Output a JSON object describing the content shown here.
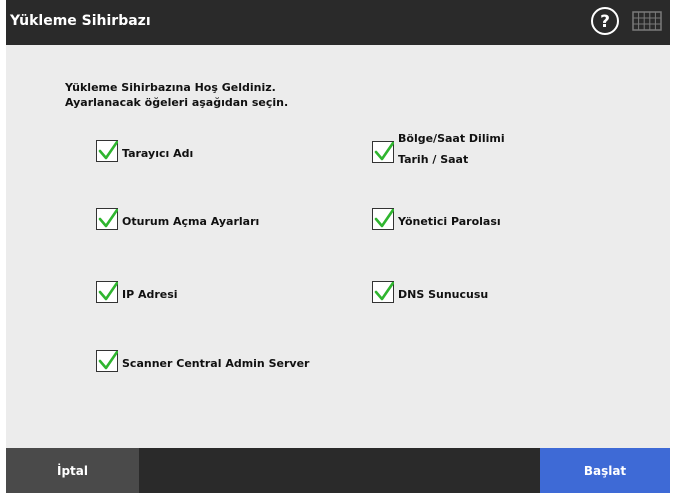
{
  "window": {
    "title": "Yükleme Sihirbazı"
  },
  "header": {
    "help_icon": "question-circle-icon",
    "keyboard_icon": "keyboard-icon"
  },
  "intro": {
    "line1": "Yükleme Sihirbazına Hoş Geldiniz.",
    "line2": "Ayarlanacak öğeleri aşağıdan seçin."
  },
  "options": {
    "scanner_name": {
      "label": "Tarayıcı Adı",
      "checked": true
    },
    "region_time": {
      "label_line1": "Bölge/Saat Dilimi",
      "label_line2": "Tarih / Saat",
      "checked": true
    },
    "logon_settings": {
      "label": "Oturum Açma Ayarları",
      "checked": true
    },
    "admin_password": {
      "label": "Yönetici Parolası",
      "checked": true
    },
    "ip_address": {
      "label": "IP Adresi",
      "checked": true
    },
    "dns_server": {
      "label": "DNS Sunucusu",
      "checked": true
    },
    "scanner_central": {
      "label": "Scanner Central Admin Server",
      "checked": true
    }
  },
  "footer": {
    "cancel_label": "İptal",
    "start_label": "Başlat"
  },
  "colors": {
    "titlebar": "#2a2a2a",
    "background": "#ececec",
    "checkmark": "#2fb52f",
    "start_button": "#3e6ad6",
    "cancel_button": "#4a4a4a"
  }
}
